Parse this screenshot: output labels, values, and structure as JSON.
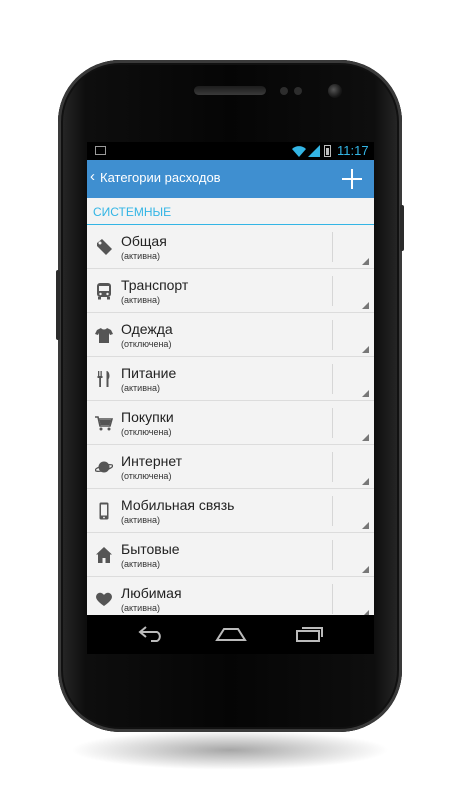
{
  "status_bar": {
    "time": "11:17",
    "icons": [
      "picture-icon",
      "wifi-icon",
      "signal-icon",
      "battery-icon"
    ]
  },
  "action_bar": {
    "back_glyph": "‹",
    "title": "Категории расходов",
    "add_icon": "plus-icon"
  },
  "section": {
    "header": "СИСТЕМНЫЕ"
  },
  "categories": [
    {
      "name": "Общая",
      "status": "(активна)",
      "icon": "tag-icon"
    },
    {
      "name": "Транспорт",
      "status": "(активна)",
      "icon": "bus-icon"
    },
    {
      "name": "Одежда",
      "status": "(отключена)",
      "icon": "shirt-icon"
    },
    {
      "name": "Питание",
      "status": "(активна)",
      "icon": "cutlery-icon"
    },
    {
      "name": "Покупки",
      "status": "(отключена)",
      "icon": "cart-icon"
    },
    {
      "name": "Интернет",
      "status": "(отключена)",
      "icon": "planet-icon"
    },
    {
      "name": "Мобильная связь",
      "status": "(активна)",
      "icon": "mobile-phone-icon"
    },
    {
      "name": "Бытовые",
      "status": "(активна)",
      "icon": "house-icon"
    },
    {
      "name": "Любимая",
      "status": "(активна)",
      "icon": "heart-icon"
    }
  ],
  "nav_bar": {
    "buttons": [
      "back-nav-icon",
      "home-nav-icon",
      "recent-apps-icon"
    ]
  },
  "colors": {
    "accent": "#33b5e5",
    "action_bar": "#3f8fd0",
    "list_bg": "#f3f3f3"
  }
}
